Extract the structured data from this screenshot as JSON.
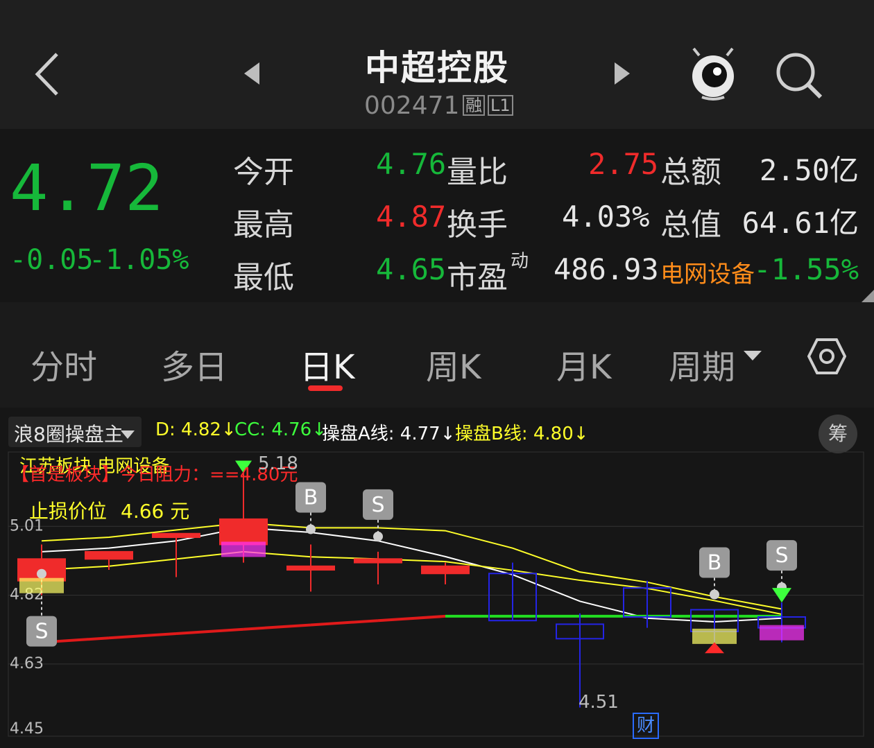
{
  "header": {
    "title": "中超控股",
    "code": "002471",
    "badge_margin": "融",
    "badge_level": "L1",
    "icons": [
      "back-icon",
      "prev-stock-icon",
      "next-stock-icon",
      "mascot-icon",
      "search-icon"
    ]
  },
  "quote": {
    "price": "4.72",
    "change": "-0.05",
    "change_pct": "-1.05%",
    "open_label": "今开",
    "open": "4.76",
    "high_label": "最高",
    "high": "4.87",
    "low_label": "最低",
    "low": "4.65",
    "vol_ratio_label": "量比",
    "vol_ratio": "2.75",
    "turnover_label": "换手",
    "turnover": "4.03%",
    "pe_label": "市盈",
    "pe_sup": "动",
    "pe": "486.93",
    "amount_label": "总额",
    "amount": "2.50亿",
    "mktcap_label": "总值",
    "mktcap": "64.61亿",
    "sector": "电网设备",
    "sector_pct": "-1.55%"
  },
  "tabs": [
    "分时",
    "多日",
    "日K",
    "周K",
    "月K",
    "周期"
  ],
  "active_tab": "日K",
  "indicator": {
    "name": "浪8圈操盘主",
    "d": "D: 4.82↓",
    "cc": "CC: 4.76↓",
    "a": "操盘A线: 4.77↓",
    "b": "操盘B线: 4.80↓",
    "right_button": "筹"
  },
  "overlay": {
    "line1": "江苏板块 电网设备",
    "line2": "【首是板块】今日阻力：==4.80元",
    "stop_label": "止损价位",
    "stop_value": "4.66 元",
    "top_value": "5.18",
    "low_value": "4.51",
    "fin_badge": "财"
  },
  "chart_data": {
    "type": "candlestick",
    "y_ticks": [
      "5.01",
      "4.82",
      "4.63",
      "4.45"
    ],
    "signals": [
      {
        "label": "S",
        "index": 0
      },
      {
        "label": "B",
        "index": 4
      },
      {
        "label": "S",
        "index": 5
      },
      {
        "label": "B",
        "index": 10
      },
      {
        "label": "S",
        "index": 11
      }
    ],
    "ylim": [
      4.45,
      5.2
    ],
    "candles": [
      {
        "o": 4.86,
        "c": 4.92,
        "h": 4.96,
        "l": 4.82,
        "color": "#f02b2b"
      },
      {
        "o": 4.92,
        "c": 4.94,
        "h": 4.94,
        "l": 4.89,
        "color": "#f02b2b"
      },
      {
        "o": 4.98,
        "c": 4.99,
        "h": 4.99,
        "l": 4.87,
        "color": "#f02b2b"
      },
      {
        "o": 4.96,
        "c": 5.03,
        "h": 5.18,
        "l": 4.91,
        "color": "#f02b2b"
      },
      {
        "o": 4.89,
        "c": 4.9,
        "h": 4.96,
        "l": 4.83,
        "color": "#f02b2b"
      },
      {
        "o": 4.91,
        "c": 4.92,
        "h": 4.94,
        "l": 4.85,
        "color": "#f02b2b"
      },
      {
        "o": 4.88,
        "c": 4.9,
        "h": 4.91,
        "l": 4.85,
        "color": "#f02b2b"
      },
      {
        "o": 4.88,
        "c": 4.75,
        "h": 4.91,
        "l": 4.75,
        "color": "#2424e6"
      },
      {
        "o": 4.74,
        "c": 4.7,
        "h": 4.77,
        "l": 4.51,
        "color": "#2424e6"
      },
      {
        "o": 4.84,
        "c": 4.76,
        "h": 4.86,
        "l": 4.73,
        "color": "#2424e6"
      },
      {
        "o": 4.78,
        "c": 4.72,
        "h": 4.78,
        "l": 4.69,
        "color": "#2424e6"
      },
      {
        "o": 4.76,
        "c": 4.73,
        "h": 4.8,
        "l": 4.69,
        "color": "#2424e6"
      }
    ]
  }
}
